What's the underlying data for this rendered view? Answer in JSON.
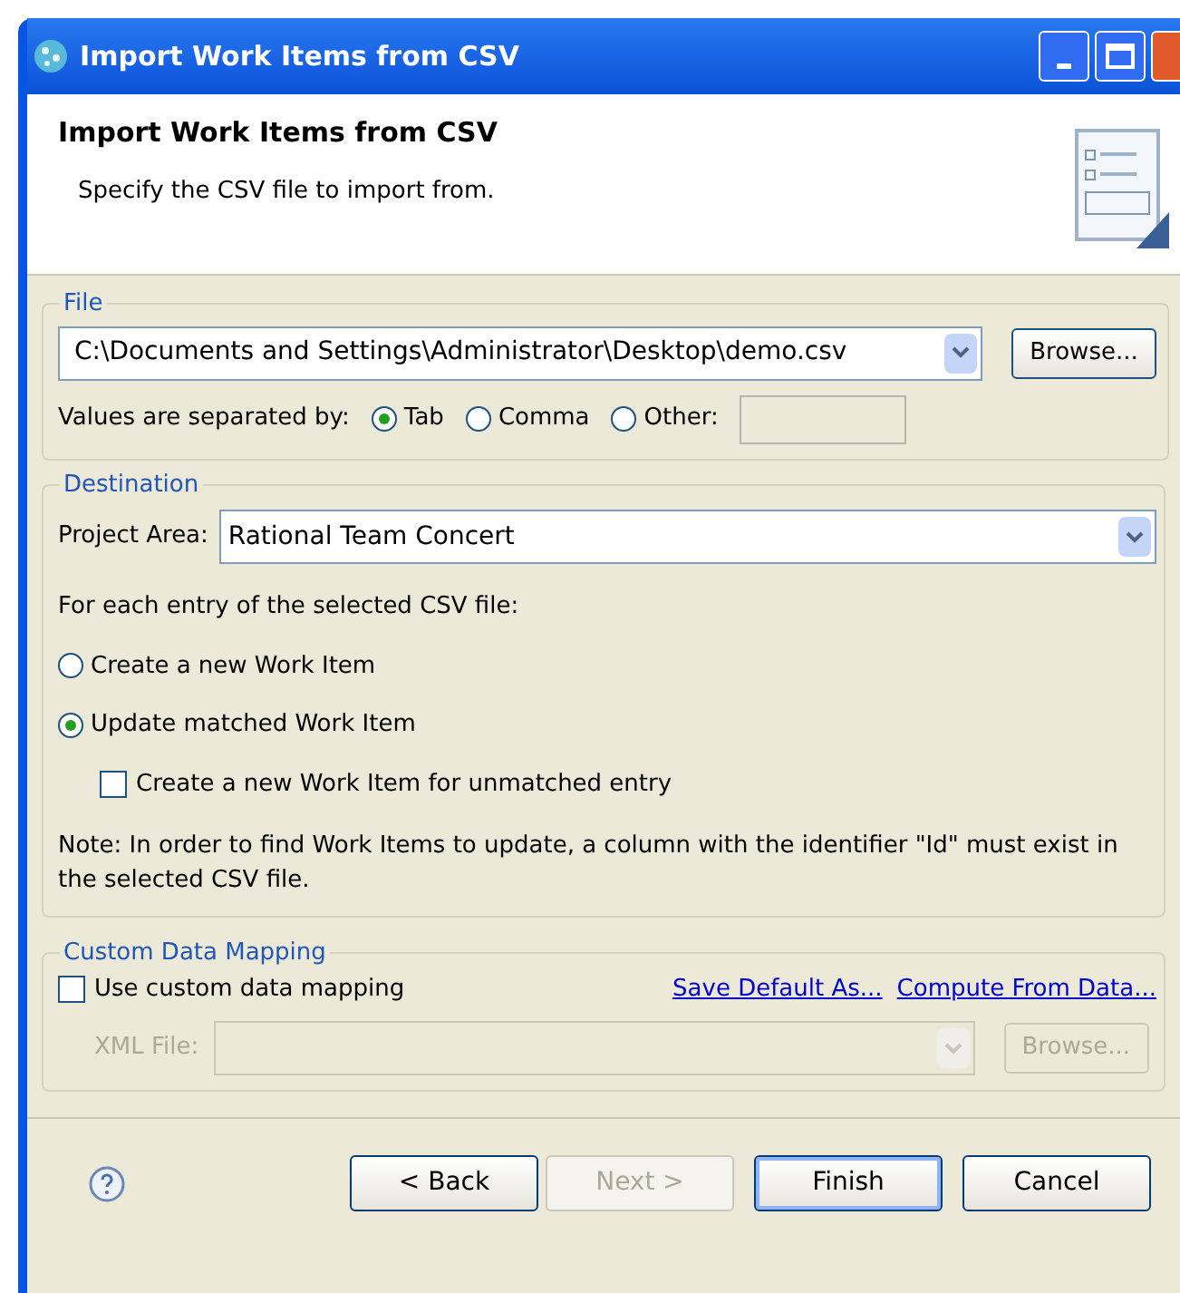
{
  "window": {
    "title": "Import Work Items from CSV"
  },
  "header": {
    "title": "Import Work Items from CSV",
    "description": "Specify the CSV file to import from."
  },
  "file_group": {
    "legend": "File",
    "path": "C:\\Documents and Settings\\Administrator\\Desktop\\demo.csv",
    "browse": "Browse...",
    "separator_label": "Values are separated by:",
    "separators": [
      {
        "label": "Tab",
        "selected": true
      },
      {
        "label": "Comma",
        "selected": false
      },
      {
        "label": "Other:",
        "selected": false
      }
    ]
  },
  "destination": {
    "legend": "Destination",
    "project_area_label": "Project Area:",
    "project_area": "Rational Team Concert",
    "prompt": "For each entry of the selected CSV file:",
    "options": [
      {
        "label": "Create a new Work Item",
        "selected": false
      },
      {
        "label": "Update matched Work Item",
        "selected": true
      }
    ],
    "unmatched": {
      "label": "Create a new Work Item for unmatched entry",
      "checked": false
    },
    "note": "Note: In order to find Work Items to update, a column with the identifier \"Id\" must exist in the selected CSV file."
  },
  "custom_mapping": {
    "legend": "Custom Data Mapping",
    "checkbox": {
      "label": "Use custom data mapping",
      "checked": false
    },
    "links": [
      "Save Default As...",
      "Compute From Data..."
    ],
    "xml_label": "XML File:",
    "disabled": true,
    "browse": "Browse..."
  },
  "buttons": [
    {
      "label": "< Back",
      "disabled": false,
      "default": false
    },
    {
      "label": "Next >",
      "disabled": true,
      "default": false
    },
    {
      "label": "Finish",
      "disabled": false,
      "default": true
    },
    {
      "label": "Cancel",
      "disabled": false,
      "default": false
    }
  ]
}
